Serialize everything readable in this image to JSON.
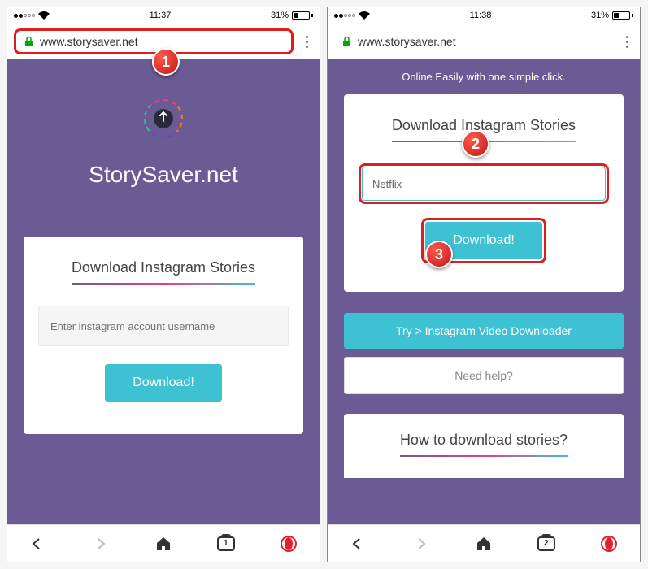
{
  "status": {
    "time_left": "11:37",
    "time_right": "11:38",
    "battery": "31%"
  },
  "address": {
    "url": "www.storysaver.net"
  },
  "left": {
    "hero_title": "StorySaver.net",
    "card_title": "Download Instagram Stories",
    "input_placeholder": "Enter instagram account username",
    "download_label": "Download!"
  },
  "right": {
    "tagline": "Online Easily with one simple click.",
    "card_title": "Download Instagram Stories",
    "input_value": "Netflix",
    "download_label": "Download!",
    "try_label": "Try > Instagram Video Downloader",
    "help_label": "Need help?",
    "howto_title": "How to download stories?"
  },
  "nav": {
    "tabs_left": "1",
    "tabs_right": "2"
  },
  "steps": {
    "one": "1",
    "two": "2",
    "three": "3"
  }
}
